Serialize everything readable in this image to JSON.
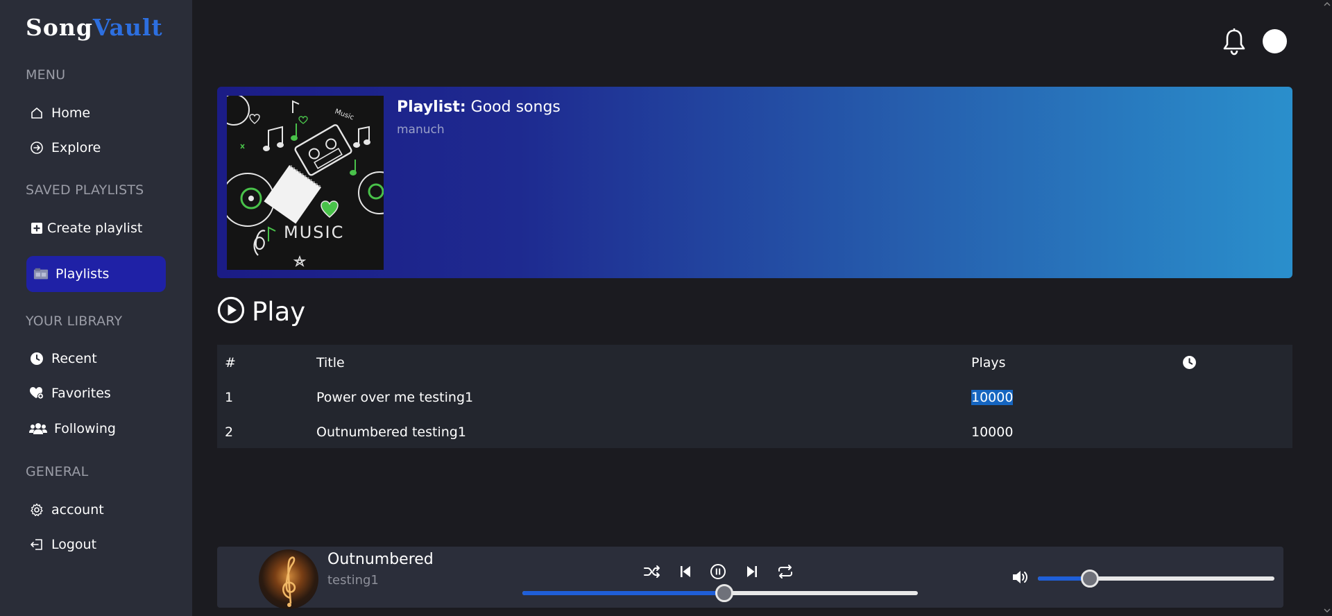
{
  "app": {
    "logo_part1": "Song",
    "logo_part2": "Vault",
    "brand_color": "#2d6fe0"
  },
  "sidebar": {
    "sections": {
      "menu": "MENU",
      "saved": "SAVED PLAYLISTS",
      "library": "YOUR LIBRARY",
      "general": "GENERAL"
    },
    "items": [
      {
        "label": "Home",
        "icon": "home-icon"
      },
      {
        "label": "Explore",
        "icon": "explore-icon"
      },
      {
        "label": "Create playlist",
        "icon": "plus-square-icon"
      },
      {
        "label": "Playlists",
        "icon": "playlists-icon",
        "active": true
      },
      {
        "label": "Recent",
        "icon": "clock-icon"
      },
      {
        "label": "Favorites",
        "icon": "heart-plus-icon"
      },
      {
        "label": "Following",
        "icon": "users-icon"
      },
      {
        "label": "account",
        "icon": "gear-icon"
      },
      {
        "label": "Logout",
        "icon": "logout-icon"
      }
    ],
    "active_color": "#1f21a6"
  },
  "header": {
    "icons": [
      "bell-icon",
      "avatar"
    ]
  },
  "playlist": {
    "label": "Playlist:",
    "name": "Good songs",
    "owner": "manuch",
    "cover_text": "MUSIC"
  },
  "play_button": {
    "label": "Play"
  },
  "table": {
    "columns": [
      "#",
      "Title",
      "Plays"
    ],
    "duration_icon": "clock-icon",
    "rows": [
      {
        "num": "1",
        "title": "Power over me testing1",
        "plays": "10000",
        "selected": true
      },
      {
        "num": "2",
        "title": "Outnumbered testing1",
        "plays": "10000"
      }
    ]
  },
  "player": {
    "title": "Outnumbered",
    "artist": "testing1",
    "controls": [
      "shuffle-icon",
      "previous-icon",
      "pause-icon",
      "next-icon",
      "repeat-icon"
    ],
    "progress_fraction": 0.51,
    "volume_icon": "volume-icon",
    "volume_fraction": 0.22,
    "accent_color": "#1f5fd8"
  }
}
